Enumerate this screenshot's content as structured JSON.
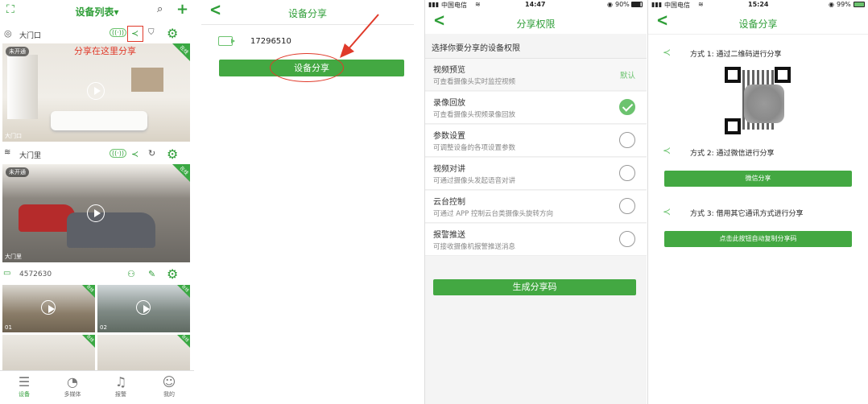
{
  "panel1": {
    "title": "设备列表",
    "title_caret": "▾",
    "icons": {
      "scan": "scan-icon",
      "search": "search-icon",
      "add": "plus-icon"
    },
    "camera1": {
      "name": "大门口",
      "badge": "未开通",
      "status": "在线",
      "caption": "大门口"
    },
    "annotation": "分享在这里分享",
    "camera2": {
      "name": "大门里",
      "badge": "未开通",
      "status": "在线",
      "caption": "大门里"
    },
    "nvr": {
      "name": "4572630"
    },
    "grid": [
      {
        "caption": "01",
        "status": "在线"
      },
      {
        "caption": "02",
        "status": "在线"
      },
      {
        "caption": "",
        "status": "在线"
      },
      {
        "caption": "",
        "status": "在线"
      }
    ],
    "tabs": [
      {
        "label": "设备",
        "icon": "list-icon"
      },
      {
        "label": "多媒体",
        "icon": "media-icon"
      },
      {
        "label": "报警",
        "icon": "bell-icon"
      },
      {
        "label": "我的",
        "icon": "user-icon"
      }
    ]
  },
  "panel2": {
    "title": "设备分享",
    "device_id": "17296510",
    "share_button": "设备分享",
    "accent": "#43a842",
    "annotation_color": "#e03a2a"
  },
  "panel3": {
    "status": {
      "carrier": "中国电信",
      "time": "14:47",
      "battery": "90%"
    },
    "title": "分享权限",
    "section": "选择你要分享的设备权限",
    "permissions": [
      {
        "title": "视频预览",
        "desc": "可查看摄像头实时监控视频",
        "state": "默认"
      },
      {
        "title": "录像回放",
        "desc": "可查看摄像头视频录像回放",
        "state": "checked"
      },
      {
        "title": "参数设置",
        "desc": "可调整设备的各项设置参数",
        "state": "unchecked"
      },
      {
        "title": "视频对讲",
        "desc": "可通过摄像头发起语音对讲",
        "state": "unchecked"
      },
      {
        "title": "云台控制",
        "desc": "可通过 APP 控制云台类摄像头旋转方向",
        "state": "unchecked"
      },
      {
        "title": "报警推送",
        "desc": "可接收摄像机报警推送消息",
        "state": "unchecked"
      }
    ],
    "generate_button": "生成分享码"
  },
  "panel4": {
    "status": {
      "carrier": "中国电信",
      "time": "15:24",
      "battery": "99%"
    },
    "title": "设备分享",
    "method1": "方式 1: 通过二维码进行分享",
    "method2": "方式 2: 通过微信进行分享",
    "wechat_button": "微信分享",
    "method3": "方式 3: 借用其它通讯方式进行分享",
    "copy_button": "点击此按钮自动复制分享码"
  }
}
